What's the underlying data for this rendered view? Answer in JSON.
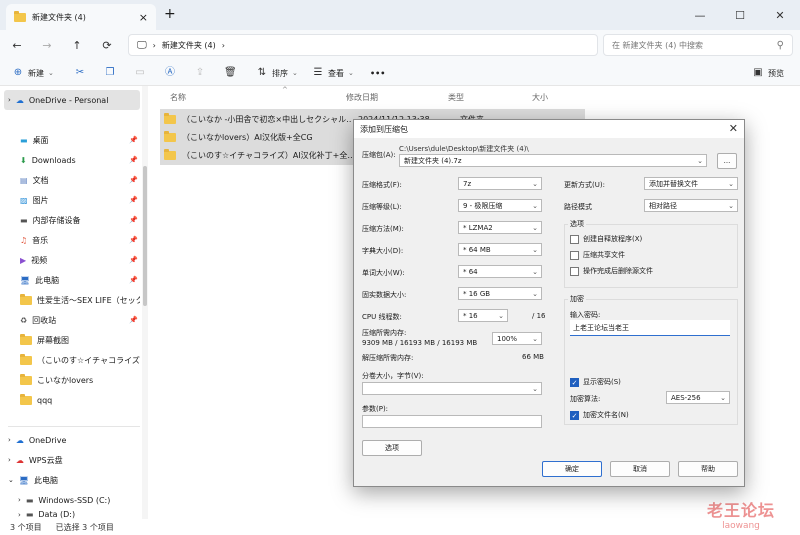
{
  "tab": {
    "title": "新建文件夹 (4)",
    "close": "×",
    "new_tab": "+"
  },
  "window": {
    "minimize": "—",
    "maximize": "☐",
    "close": "✕"
  },
  "nav": {
    "back": "←",
    "forward": "→",
    "up": "↑",
    "refresh": "⟳",
    "monitor": "🖵",
    "crumb_sep": "›",
    "breadcrumb": "新建文件夹 (4)",
    "search_placeholder": "在 新建文件夹 (4) 中搜索"
  },
  "toolbar": {
    "new_label": "新建",
    "sort_label": "排序",
    "view_label": "查看",
    "more": "•••",
    "preview_label": "预览"
  },
  "sidebar": {
    "onedrive_personal": "OneDrive - Personal",
    "items": [
      {
        "label": "桌面",
        "icon": "desktop-icon"
      },
      {
        "label": "Downloads",
        "icon": "download-icon"
      },
      {
        "label": "文档",
        "icon": "document-icon"
      },
      {
        "label": "图片",
        "icon": "picture-icon"
      },
      {
        "label": "内部存储设备",
        "icon": "storage-icon"
      },
      {
        "label": "音乐",
        "icon": "music-icon"
      },
      {
        "label": "视频",
        "icon": "video-icon"
      },
      {
        "label": "此电脑",
        "icon": "pc-icon"
      },
      {
        "label": "性爱生活～SEX LIFE（セック",
        "icon": "folder-icon"
      },
      {
        "label": "回收站",
        "icon": "recycle-icon"
      },
      {
        "label": "屏幕截图",
        "icon": "folder-icon"
      },
      {
        "label": "（こいのす☆イチャコライズ）",
        "icon": "folder-icon"
      },
      {
        "label": "こいなかlovers",
        "icon": "folder-icon"
      },
      {
        "label": "qqq",
        "icon": "folder-icon"
      }
    ],
    "bottom": [
      {
        "label": "OneDrive"
      },
      {
        "label": "WPS云盘"
      },
      {
        "label": "此电脑"
      },
      {
        "label": "Windows-SSD (C:)"
      },
      {
        "label": "Data (D:)"
      }
    ]
  },
  "list": {
    "col_name": "名称",
    "col_date": "修改日期",
    "col_type": "类型",
    "col_size": "大小",
    "rows": [
      {
        "name": "（こいなか -小田舎で初恋×中出しセクシャル…",
        "date": "2024/11/12 13:38",
        "type": "文件夹"
      },
      {
        "name": "（こいなかlovers）AI汉化版+全CG",
        "date": "20"
      },
      {
        "name": "（こいのす☆イチャコライズ）AI汉化补丁+全…",
        "date": "20"
      }
    ]
  },
  "status": {
    "count": "3 个项目",
    "selected": "已选择 3 个项目"
  },
  "watermark": {
    "cn": "老王论坛",
    "en": "laowang"
  },
  "dialog": {
    "title": "添加到压缩包",
    "archive_label": "压缩包(A):",
    "archive_path": "C:\\Users\\dule\\Desktop\\新建文件夹 (4)\\",
    "archive_name": "新建文件夹 (4).7z",
    "browse": "...",
    "format_label": "压缩格式(F):",
    "format": "7z",
    "level_label": "压缩等级(L):",
    "level": "9 - 极限压缩",
    "method_label": "压缩方法(M):",
    "method": "* LZMA2",
    "dict_label": "字典大小(D):",
    "dict": "* 64 MB",
    "word_label": "单词大小(W):",
    "word": "* 64",
    "solid_label": "固实数据大小:",
    "solid": "* 16 GB",
    "cpu_label": "CPU 线程数:",
    "cpu": "* 16",
    "cpu_max": "/ 16",
    "mem_label": "压缩所需内存:",
    "mem_value": "9309 MB / 16193 MB / 16193 MB",
    "mem_pct": "100%",
    "decomp_label": "解压缩所需内存:",
    "decomp_value": "66 MB",
    "split_label": "分卷大小，字节(V):",
    "params_label": "参数(P):",
    "options_btn": "选项",
    "update_label": "更新方式(U):",
    "update": "添加并替换文件",
    "path_label": "路径模式",
    "path": "相对路径",
    "options_group": "选项",
    "opt1": "创建自释放程序(X)",
    "opt2": "压缩共享文件",
    "opt3": "操作完成后删除源文件",
    "enc_group": "加密",
    "pwd_label": "输入密码:",
    "pwd_value": "上老王论坛当老王",
    "show_pwd": "显示密码(S)",
    "enc_method_label": "加密算法:",
    "enc_method": "AES-256",
    "enc_names": "加密文件名(N)",
    "ok": "确定",
    "cancel": "取消",
    "help": "帮助"
  }
}
